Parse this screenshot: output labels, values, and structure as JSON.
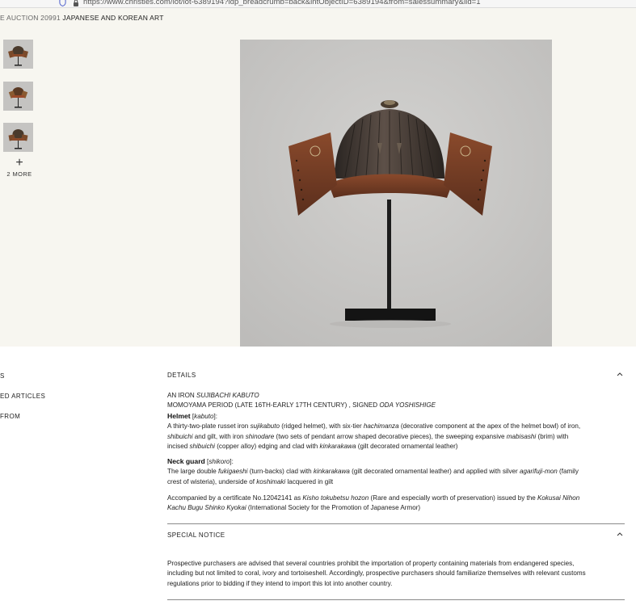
{
  "browser": {
    "url": "https://www.christies.com/lot/lot-6389194?idp_breadcrumb=back&intObjectID=6389194&from=salessummary&lid=1"
  },
  "breadcrumb": {
    "sale": "E AUCTION 20991",
    "title": "JAPANESE AND KOREAN ART"
  },
  "gallery": {
    "more_label": "2 MORE",
    "plus_glyph": "+"
  },
  "left_nav": {
    "items": [
      "S",
      "ED ARTICLES",
      "FROM"
    ]
  },
  "details": {
    "heading": "DETAILS",
    "title_line1_prefix": "AN IRON ",
    "title_line1_italic": "SUJIBACHI KABUTO",
    "title_line2_prefix": "MOMOYAMA PERIOD (LATE 16TH-EARLY 17TH CENTURY) , SIGNED ",
    "title_line2_italic": "ODA YOSHISHIGE",
    "helmet_heading": "Helmet",
    "helmet_term": "kabuto",
    "helmet_lines": [
      [
        "A thirty-two-plate russet iron ",
        "i:sujikabuto",
        " (ridged helmet), with six-tier ",
        "i:hachimanza",
        " (decorative component at the apex of the helmet bowl) of iron,"
      ],
      [
        "i:shibuichi",
        " and gilt, with iron ",
        "i:shinodare",
        " (two sets of pendant arrow shaped decorative pieces), the sweeping expansive ",
        "i:mabisashi",
        " (brim) with"
      ],
      [
        "incised ",
        "i:shibuichi",
        " (copper alloy) edging and clad with ",
        "i:kinkarakawa",
        " (gilt decorated ornamental leather)"
      ]
    ],
    "neck_heading": "Neck guard",
    "neck_term": "shikoro",
    "neck_lines": [
      [
        "The large double ",
        "i:fukigaeshi",
        " (turn-backs) clad with ",
        "i:kinkarakawa",
        " (gilt decorated ornamental leather) and applied with silver ",
        "i:agarifuji-mon",
        " (family"
      ],
      [
        "crest of wisteria), underside of ",
        "i:koshimaki",
        " lacquered in gilt"
      ]
    ],
    "cert_lines": [
      [
        "Accompanied by a certificate No.12042141 as ",
        "i:Kisho tokubetsu hozon",
        " (Rare and especially worth of preservation) issued by the ",
        "i:Kokusai Nihon"
      ],
      [
        "i:Kachu Bugu Shinko Kyokai",
        " (International Society for the Promotion of Japanese Armor)"
      ]
    ]
  },
  "special_notice": {
    "heading": "SPECIAL NOTICE",
    "lines": [
      "Prospective purchasers are advised that several countries prohibit the importation of property containing materials from endangered species,",
      "including but not limited to coral, ivory and tortoiseshell. Accordingly, prospective purchasers should familiarize themselves with relevant customs",
      "regulations prior to bidding if they intend to import this lot into another country."
    ]
  },
  "colors": {
    "hero_bg": "#f7f6f0",
    "text": "#1d1d1d",
    "divider": "#8a8a8a",
    "image_bg": "#c9c8c6"
  },
  "icons": [
    "shield-icon",
    "lock-icon",
    "plus-icon",
    "chevron-up-icon"
  ]
}
